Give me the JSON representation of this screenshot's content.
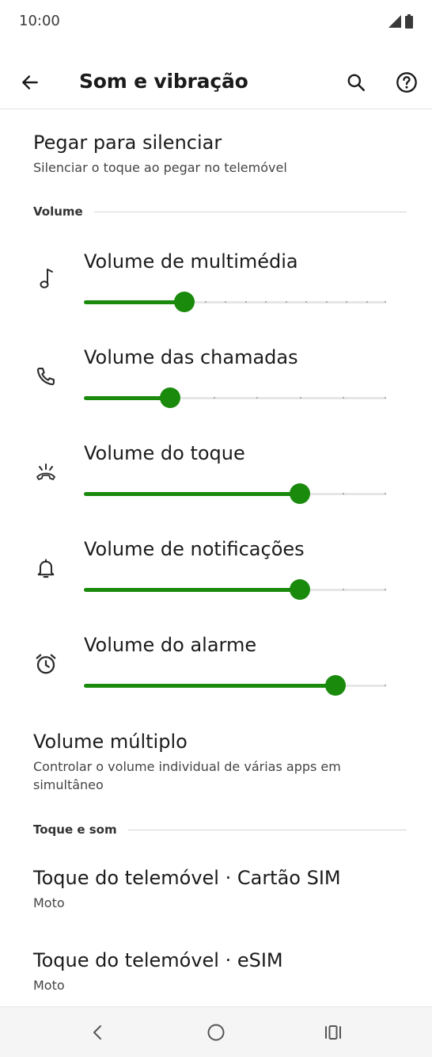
{
  "status_bar": {
    "time": "10:00",
    "signal_icon": "signal-icon",
    "battery_icon": "battery-icon"
  },
  "app_bar": {
    "title": "Som e vibração",
    "back_icon": "arrow-back-icon",
    "search_icon": "search-icon",
    "help_icon": "help-icon"
  },
  "pickup_silence": {
    "title": "Pegar para silenciar",
    "summary": "Silenciar o toque ao pegar no telemóvel"
  },
  "volume_section": {
    "label": "Volume",
    "sliders": [
      {
        "key": "media",
        "title": "Volume de multimédia",
        "icon": "music-note-icon",
        "level": 0.333,
        "ticks": 15
      },
      {
        "key": "call",
        "title": "Volume das chamadas",
        "icon": "phone-icon",
        "level": 0.286,
        "ticks": 7
      },
      {
        "key": "ring",
        "title": "Volume do toque",
        "icon": "ringer-icon",
        "level": 0.714,
        "ticks": 7
      },
      {
        "key": "notification",
        "title": "Volume de notificações",
        "icon": "bell-icon",
        "level": 0.714,
        "ticks": 7
      },
      {
        "key": "alarm",
        "title": "Volume do alarme",
        "icon": "alarm-icon",
        "level": 0.833,
        "ticks": 6
      }
    ]
  },
  "multi_volume": {
    "title": "Volume múltiplo",
    "summary": "Controlar o volume individual de várias apps em simultâneo"
  },
  "ring_section": {
    "label": "Toque e som",
    "items": [
      {
        "title": "Toque do telemóvel · Cartão SIM",
        "summary": "Moto"
      },
      {
        "title": "Toque do telemóvel · eSIM",
        "summary": "Moto"
      }
    ]
  },
  "nav_bar": {
    "back_icon": "nav-back-icon",
    "home_icon": "nav-home-icon",
    "recents_icon": "nav-recents-icon"
  },
  "colors": {
    "accent": "#1a8a0c",
    "track": "#e6e6e6",
    "text": "#1b1b1b"
  }
}
